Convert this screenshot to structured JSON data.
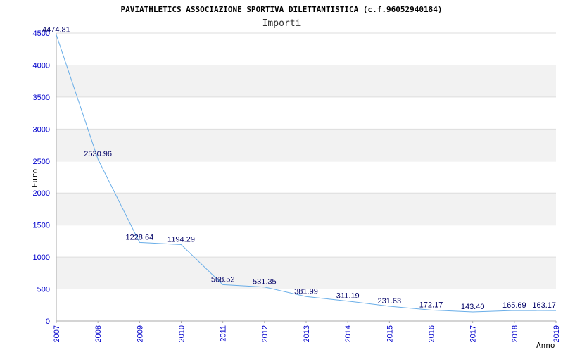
{
  "chart_data": {
    "type": "line",
    "title": "PAVIATHLETICS ASSOCIAZIONE SPORTIVA DILETTANTISTICA (c.f.96052940184)",
    "subtitle": "Importi",
    "xlabel": "Anno",
    "ylabel": "Euro",
    "x": [
      "2007",
      "2008",
      "2009",
      "2010",
      "2011",
      "2012",
      "2013",
      "2014",
      "2015",
      "2016",
      "2017",
      "2018",
      "2019"
    ],
    "values": [
      4474.81,
      2530.96,
      1228.64,
      1194.29,
      568.52,
      531.35,
      381.99,
      311.19,
      231.63,
      172.17,
      143.4,
      165.69,
      163.17
    ],
    "data_labels": [
      "4474.81",
      "2530.96",
      "1228.64",
      "1194.29",
      "568.52",
      "531.35",
      "381.99",
      "311.19",
      "231.63",
      "172.17",
      "143.40",
      "165.69",
      "163.17"
    ],
    "ylim": [
      0,
      4500
    ],
    "yticks": [
      0,
      500,
      1000,
      1500,
      2000,
      2500,
      3000,
      3500,
      4000,
      4500
    ],
    "grid": true,
    "colors": {
      "line": "#6aaee8",
      "tick_text": "#0000cc",
      "data_label": "#000066",
      "band": "#f2f2f2",
      "grid": "#dddddd",
      "axis": "#aaaaaa"
    }
  }
}
